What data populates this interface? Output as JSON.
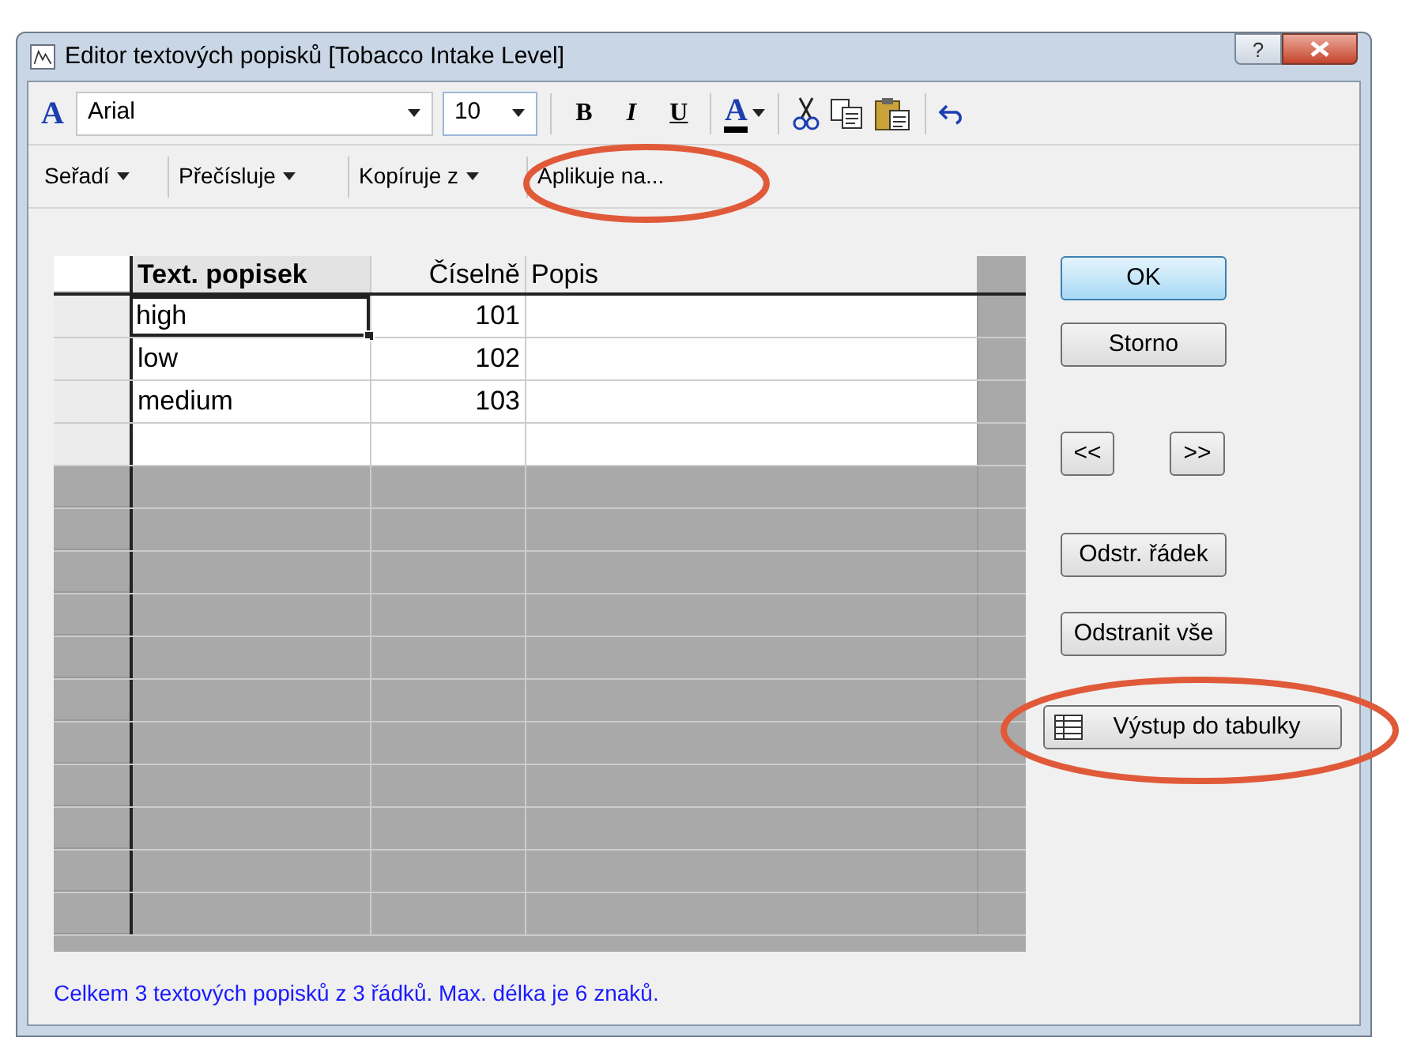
{
  "window": {
    "title": "Editor textových popisků [Tobacco Intake Level]",
    "help_button": "?"
  },
  "toolbar": {
    "font_icon": "A",
    "font": "Arial",
    "size": "10",
    "bold": "B",
    "italic": "I",
    "underline": "U",
    "text_color": "A"
  },
  "menu": [
    {
      "label": "Seřadí",
      "dropdown": true
    },
    {
      "label": "Přečísluje",
      "dropdown": true
    },
    {
      "label": "Kopíruje z",
      "dropdown": true
    },
    {
      "label": "Aplikuje na...",
      "dropdown": false
    }
  ],
  "table": {
    "columns": [
      "Text. popisek",
      "Číselně",
      "Popis"
    ],
    "rows": [
      {
        "label": "high",
        "value": "101",
        "focused": true
      },
      {
        "label": "low",
        "value": "102",
        "focused": false
      },
      {
        "label": "medium",
        "value": "103",
        "focused": false
      }
    ]
  },
  "buttons": [
    {
      "label": "OK",
      "kind": "default"
    },
    {
      "label": "Storno",
      "kind": "normal"
    },
    {
      "label": "<<",
      "kind": "nav"
    },
    {
      "label": ">>",
      "kind": "nav"
    },
    {
      "label": "Odstr. řádek",
      "kind": "normal"
    },
    {
      "label": "Odstranit vše",
      "kind": "normal"
    },
    {
      "label": "Výstup do tabulky",
      "kind": "icon"
    }
  ],
  "status_bar": "Celkem 3 textových popisků z 3 řádků. Max. délka je 6 znaků."
}
